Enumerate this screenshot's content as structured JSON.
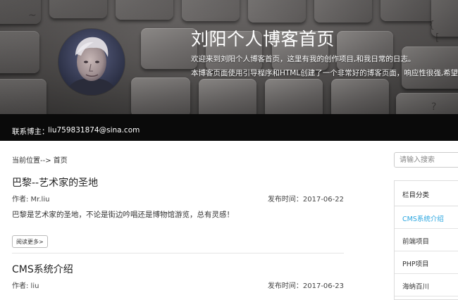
{
  "header": {
    "title": "刘阳个人博客首页",
    "desc_line1": "欢迎来到刘阳个人博客首页，这里有我的创作项目,和我日常的日志。",
    "desc_line2": "本博客页面使用引导程序和HTML创建了一个非常好的博客页面，响应性很强,希望您能喜欢。"
  },
  "contact": {
    "label": "联系博主：",
    "email": "liu759831874@sina.com"
  },
  "breadcrumb": "当前位置--> 首页",
  "posts": [
    {
      "title": "巴黎--艺术家的圣地",
      "author": "作者: Mr.liu",
      "date": "发布时间：2017-06-22",
      "summary": "巴黎是艺术家的圣地，不论是街边吟唱还是博物馆游览，总有灵感！",
      "read_more": "阅读更多>"
    },
    {
      "title": "CMS系统介绍",
      "author": "作者: liu",
      "date": "发布时间：2017-06-23"
    }
  ],
  "sidebar": {
    "search_placeholder": "请输入搜索",
    "category_title": "栏目分类",
    "categories": [
      "CMS系统介绍",
      "前端项目",
      "PHP项目",
      "海纳百川"
    ],
    "active_color": "#2aa6e0"
  },
  "icons": {
    "avatar": "avatar-portrait"
  }
}
